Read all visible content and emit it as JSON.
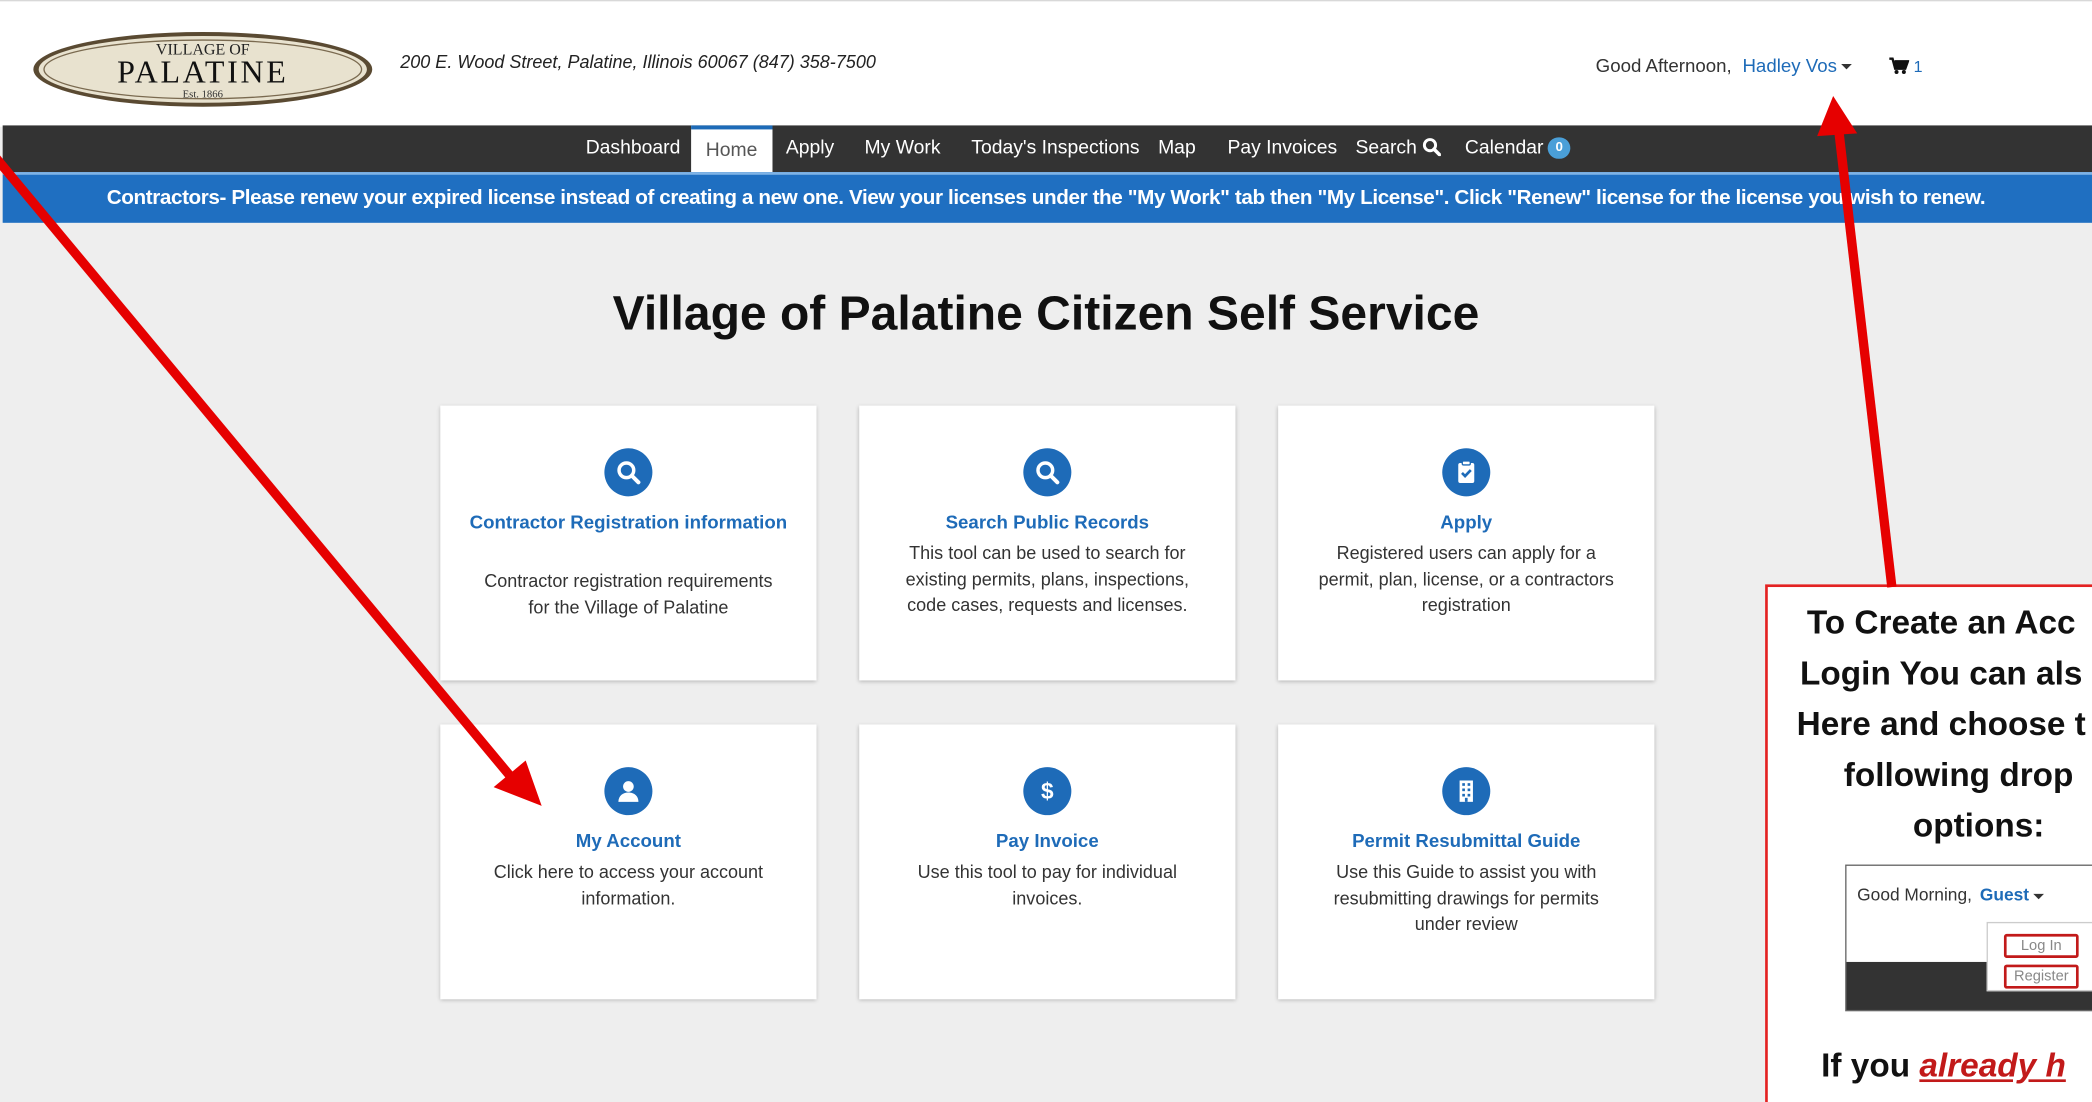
{
  "header": {
    "logo": {
      "line1": "VILLAGE OF",
      "line2": "PALATINE",
      "line3": "Est. 1866"
    },
    "address": "200 E. Wood Street, Palatine, Illinois 60067  (847) 358-7500",
    "greeting": "Good Afternoon,",
    "user_name": "Hadley Vos",
    "cart_count": "1"
  },
  "nav": {
    "items": [
      {
        "label": "Dashboard"
      },
      {
        "label": "Home"
      },
      {
        "label": "Apply"
      },
      {
        "label": "My Work"
      },
      {
        "label": "Today's Inspections"
      },
      {
        "label": "Map"
      },
      {
        "label": "Pay Invoices"
      },
      {
        "label": "Search"
      },
      {
        "label": "Calendar"
      }
    ],
    "calendar_badge": "0",
    "active": "Home"
  },
  "banner": {
    "text": "Contractors- Please renew your expired license instead of creating a new one. View your licenses under the \"My Work\" tab then \"My License\". Click  \"Renew\" license for the license you wish to renew."
  },
  "main": {
    "title": "Village of Palatine Citizen Self Service",
    "cards": [
      {
        "icon": "search-icon",
        "title": "Contractor Registration information",
        "desc": "Contractor registration requirements for the Village of Palatine"
      },
      {
        "icon": "search-icon",
        "title": "Search Public Records",
        "desc": "This tool can be used to search for existing permits, plans, inspections, code cases, requests and licenses."
      },
      {
        "icon": "clipboard-check-icon",
        "title": "Apply",
        "desc": "Registered users can apply for a permit, plan, license, or a contractors registration"
      },
      {
        "icon": "user-icon",
        "title": "My Account",
        "desc": "Click here to access your account information."
      },
      {
        "icon": "dollar-icon",
        "title": "Pay Invoice",
        "desc": "Use this tool to pay for individual invoices."
      },
      {
        "icon": "building-icon",
        "title": "Permit Resubmittal Guide",
        "desc": "Use this Guide to assist you with resubmitting drawings for permits under review"
      }
    ]
  },
  "callout": {
    "lines": [
      "To Create an Acc",
      "Login You can als",
      "Here and choose t",
      "following drop",
      "options:"
    ],
    "mini": {
      "greeting": "Good Morning,",
      "guest": "Guest",
      "login": "Log In",
      "register": "Register"
    },
    "foot_prefix": "If you ",
    "foot_emph": "already h"
  },
  "colors": {
    "accent": "#1e6bb8",
    "nav_bg": "#333333",
    "banner_bg": "#1f6fc1",
    "arrow": "#e60000"
  }
}
